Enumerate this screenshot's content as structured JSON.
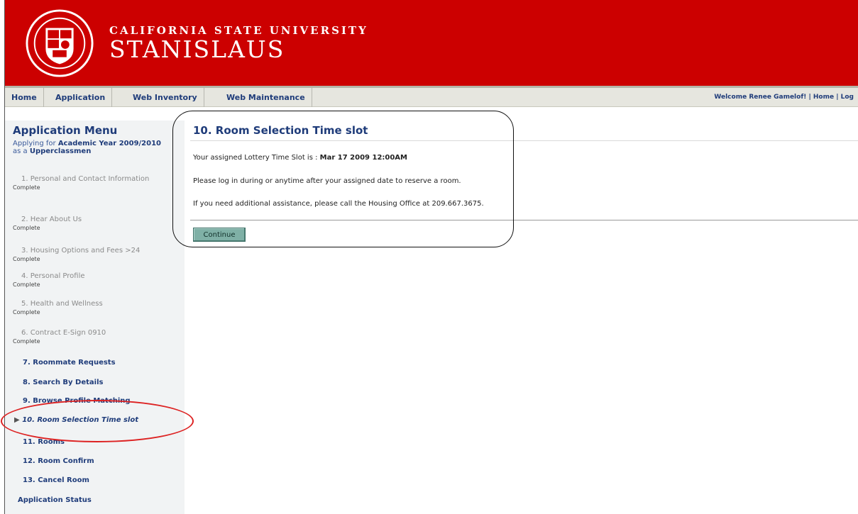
{
  "header": {
    "title_top": "CALIFORNIA STATE UNIVERSITY",
    "title_main": "STANISLAUS",
    "brand_color": "#cc0000"
  },
  "nav": {
    "items": [
      "Home",
      "Application",
      "Web Inventory",
      "Web Maintenance"
    ],
    "right": "Welcome Renee Gamelof! | Home | Log"
  },
  "sidebar": {
    "title": "Application Menu",
    "applying_prefix": "Applying for ",
    "year": "Academic Year 2009/2010",
    "as_prefix": "as a ",
    "class": "Upperclassmen",
    "steps": [
      {
        "label": "1. Personal and Contact Information",
        "status": "Complete"
      },
      {
        "label": "2. Hear About Us",
        "status": "Complete"
      },
      {
        "label": "3. Housing Options and Fees >24",
        "status": "Complete"
      },
      {
        "label": "4. Personal Profile",
        "status": "Complete"
      },
      {
        "label": "5. Health and Wellness",
        "status": "Complete"
      },
      {
        "label": "6. Contract E-Sign 0910",
        "status": "Complete"
      }
    ],
    "links": [
      "7. Roommate Requests",
      "8. Search By Details",
      "9. Browse Profile Matching"
    ],
    "active": "10. Room Selection Time slot",
    "links_after": [
      "11. Rooms",
      "12. Room Confirm",
      "13. Cancel Room"
    ],
    "status_link": "Application Status"
  },
  "main": {
    "title": "10. Room Selection Time slot",
    "slot_prefix": "Your assigned Lottery Time Slot is : ",
    "slot_value": "Mar 17 2009 12:00AM",
    "instruction": "Please log in during or anytime after your assigned date to reserve a room.",
    "help": "If you need additional assistance, please call the Housing Office at 209.667.3675.",
    "continue_label": "Continue"
  },
  "icons": {
    "active_marker": "triangle-right-icon"
  }
}
